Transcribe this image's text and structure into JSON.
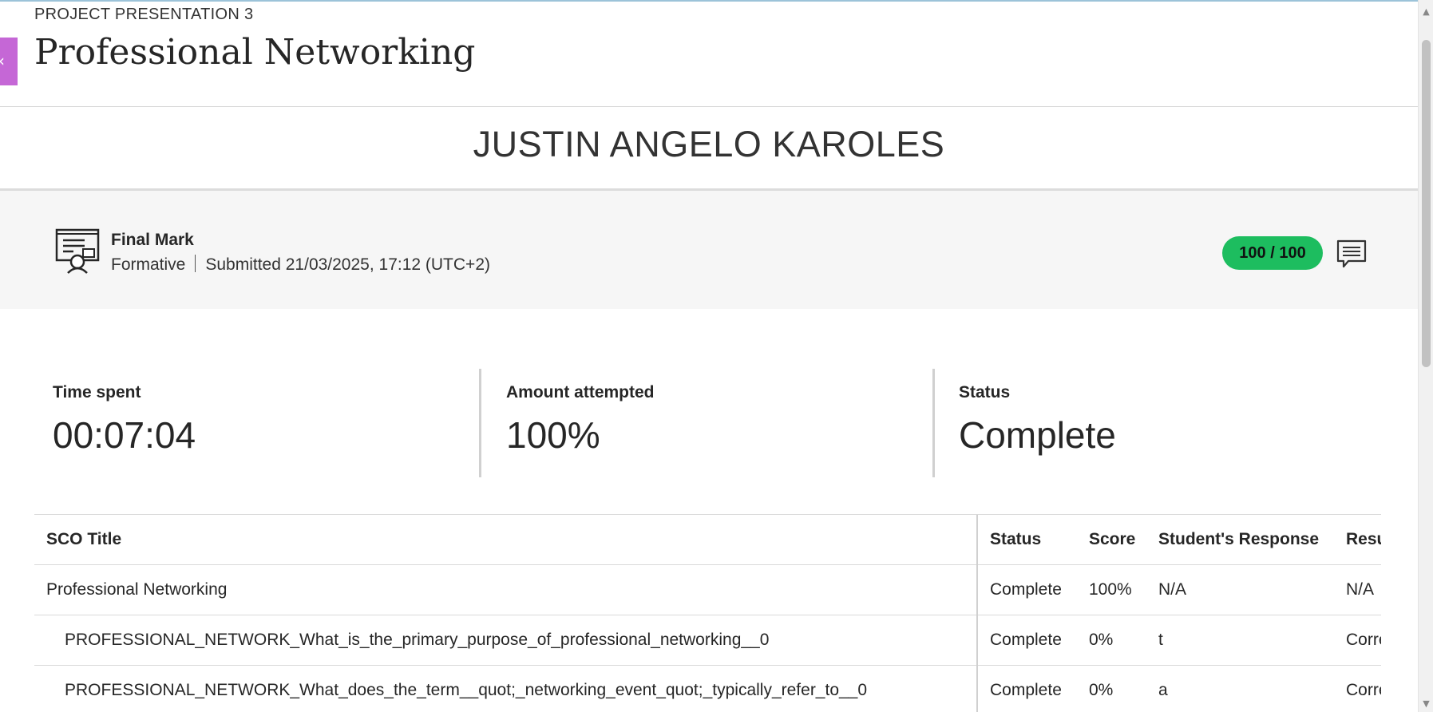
{
  "header": {
    "eyebrow": "PROJECT PRESENTATION 3",
    "title": "Professional Networking"
  },
  "student": {
    "name": "JUSTIN ANGELO KAROLES"
  },
  "final_mark": {
    "label": "Final Mark",
    "type": "Formative",
    "submitted": "Submitted 21/03/2025, 17:12 (UTC+2)",
    "score": "100 / 100",
    "score_color": "#1dbd5f",
    "icon": "certificate-icon",
    "feedback_icon": "comment-icon"
  },
  "stats": [
    {
      "label": "Time spent",
      "value": "00:07:04"
    },
    {
      "label": "Amount attempted",
      "value": "100%"
    },
    {
      "label": "Status",
      "value": "Complete"
    }
  ],
  "table": {
    "columns": [
      "SCO Title",
      "Status",
      "Score",
      "Student's Response",
      "Resu"
    ],
    "rows": [
      [
        "Professional Networking",
        "Complete",
        "100%",
        "N/A",
        "N/A"
      ],
      [
        "PROFESSIONAL_NETWORK_What_is_the_primary_purpose_of_professional_networking__0",
        "Complete",
        "0%",
        "t",
        "Corre"
      ],
      [
        "PROFESSIONAL_NETWORK_What_does_the_term__quot;_networking_event_quot;_typically_refer_to__0",
        "Complete",
        "0%",
        "a",
        "Corre"
      ]
    ]
  },
  "theme": {
    "accent_tab": "#c567d6"
  }
}
